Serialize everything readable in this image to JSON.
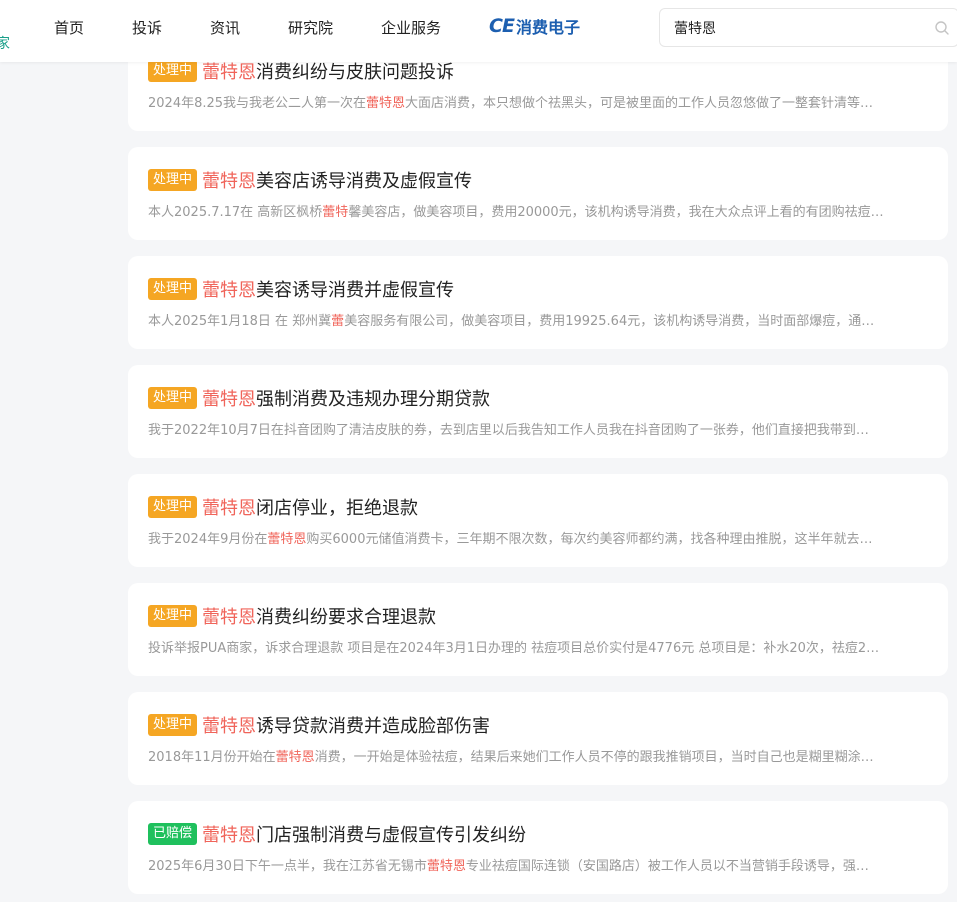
{
  "nav": {
    "edge_fragment": "家",
    "items": [
      "首页",
      "投诉",
      "资讯",
      "研究院",
      "企业服务"
    ],
    "logo_mark": "CE",
    "logo_text": "消费电子"
  },
  "search": {
    "value": "蕾特恩",
    "placeholder": ""
  },
  "colors": {
    "accent_red": "#f0645a",
    "processing_badge": "#f5a623",
    "compensated_badge": "#1fc05d",
    "logo_blue": "#1d5fb0"
  },
  "complaints": [
    {
      "status": "处理中",
      "title_highlight": "蕾特恩",
      "title_rest": "消费纠纷与皮肤问题投诉",
      "desc": [
        {
          "text": "2024年8.25我与我老公二人第一次在",
          "hl": false
        },
        {
          "text": "蕾特恩",
          "hl": true
        },
        {
          "text": "大面店消费，本只想做个祛黑头，可是被里面的工作人员忽悠做了一整套针清等…",
          "hl": false
        }
      ]
    },
    {
      "status": "处理中",
      "title_highlight": "蕾特恩",
      "title_rest": "美容店诱导消费及虚假宣传",
      "desc": [
        {
          "text": "本人2025.7.17在 高新区枫桥",
          "hl": false
        },
        {
          "text": "蕾特",
          "hl": true
        },
        {
          "text": "馨美容店，做美容项目，费用20000元，该机构诱导消费，我在大众点评上看的有团购祛痘…",
          "hl": false
        }
      ]
    },
    {
      "status": "处理中",
      "title_highlight": "蕾特恩",
      "title_rest": "美容诱导消费并虚假宣传",
      "desc": [
        {
          "text": "本人2025年1月18日 在 郑州冀",
          "hl": false
        },
        {
          "text": "蕾",
          "hl": true
        },
        {
          "text": "美容服务有限公司，做美容项目，费用19925.64元，该机构诱导消费，当时面部爆痘，通…",
          "hl": false
        }
      ]
    },
    {
      "status": "处理中",
      "title_highlight": "蕾特恩",
      "title_rest": "强制消费及违规办理分期贷款",
      "desc": [
        {
          "text": "我于2022年10月7日在抖音团购了清洁皮肤的券，去到店里以后我告知工作人员我在抖音团购了一张券，他们直接把我带到…",
          "hl": false
        }
      ]
    },
    {
      "status": "处理中",
      "title_highlight": "蕾特恩",
      "title_rest": "闭店停业，拒绝退款",
      "desc": [
        {
          "text": "我于2024年9月份在",
          "hl": false
        },
        {
          "text": "蕾特恩",
          "hl": true
        },
        {
          "text": "购买6000元储值消费卡，三年期不限次数，每次约美容师都约满，找各种理由推脱，这半年就去…",
          "hl": false
        }
      ]
    },
    {
      "status": "处理中",
      "title_highlight": "蕾特恩",
      "title_rest": "消费纠纷要求合理退款",
      "desc": [
        {
          "text": "投诉举报PUA商家，诉求合理退款 项目是在2024年3月1日办理的 祛痘项目总价实付是4776元 总项目是：补水20次，祛痘2…",
          "hl": false
        }
      ]
    },
    {
      "status": "处理中",
      "title_highlight": "蕾特恩",
      "title_rest": "诱导贷款消费并造成脸部伤害",
      "desc": [
        {
          "text": "2018年11月份开始在",
          "hl": false
        },
        {
          "text": "蕾特恩",
          "hl": true
        },
        {
          "text": "消费，一开始是体验祛痘，结果后来她们工作人员不停的跟我推销项目，当时自己也是糊里糊涂…",
          "hl": false
        }
      ]
    },
    {
      "status": "已赔偿",
      "title_highlight": "蕾特恩",
      "title_rest": "门店强制消费与虚假宣传引发纠纷",
      "desc": [
        {
          "text": "2025年6月30日下午一点半，我在江苏省无锡市",
          "hl": false
        },
        {
          "text": "蕾特恩",
          "hl": true
        },
        {
          "text": "专业祛痘国际连锁（安国路店）被工作人员以不当营销手段诱导，强…",
          "hl": false
        }
      ]
    }
  ]
}
